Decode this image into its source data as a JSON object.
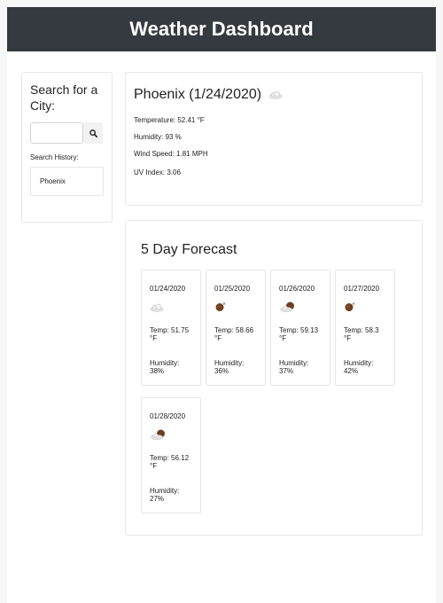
{
  "header": {
    "title": "Weather Dashboard"
  },
  "search": {
    "title": "Search for a City:",
    "input_value": "",
    "input_placeholder": "",
    "history_label": "Search History:",
    "history": [
      "Phoenix"
    ]
  },
  "current": {
    "title": "Phoenix (1/24/2020)",
    "icon": "cloud-icon",
    "temperature": "Temperature: 52.41 °F",
    "humidity": "Humidity: 93 %",
    "wind": "Wind Speed: 1.81 MPH",
    "uv": "UV Index:  3.06"
  },
  "forecast": {
    "title": "5 Day Forecast",
    "days": [
      {
        "date": "01/24/2020",
        "icon": "cloud-icon",
        "temp": "Temp: 51.75 °F",
        "humidity": "Humidity: 38%"
      },
      {
        "date": "01/25/2020",
        "icon": "night-clear-icon",
        "temp": "Temp: 58.66 °F",
        "humidity": "Humidity: 36%"
      },
      {
        "date": "01/26/2020",
        "icon": "night-cloud-icon",
        "temp": "Temp: 59.13 °F",
        "humidity": "Humidity: 37%"
      },
      {
        "date": "01/27/2020",
        "icon": "night-clear-icon",
        "temp": "Temp: 58.3 °F",
        "humidity": "Humidity: 42%"
      },
      {
        "date": "01/28/2020",
        "icon": "night-cloud-icon",
        "temp": "Temp: 56.12 °F",
        "humidity": "Humidity: 27%"
      }
    ]
  },
  "colors": {
    "header_bg": "#343a40",
    "header_text": "#ffffff",
    "page_bg": "#ffffff",
    "border": "#e6e6e6"
  }
}
